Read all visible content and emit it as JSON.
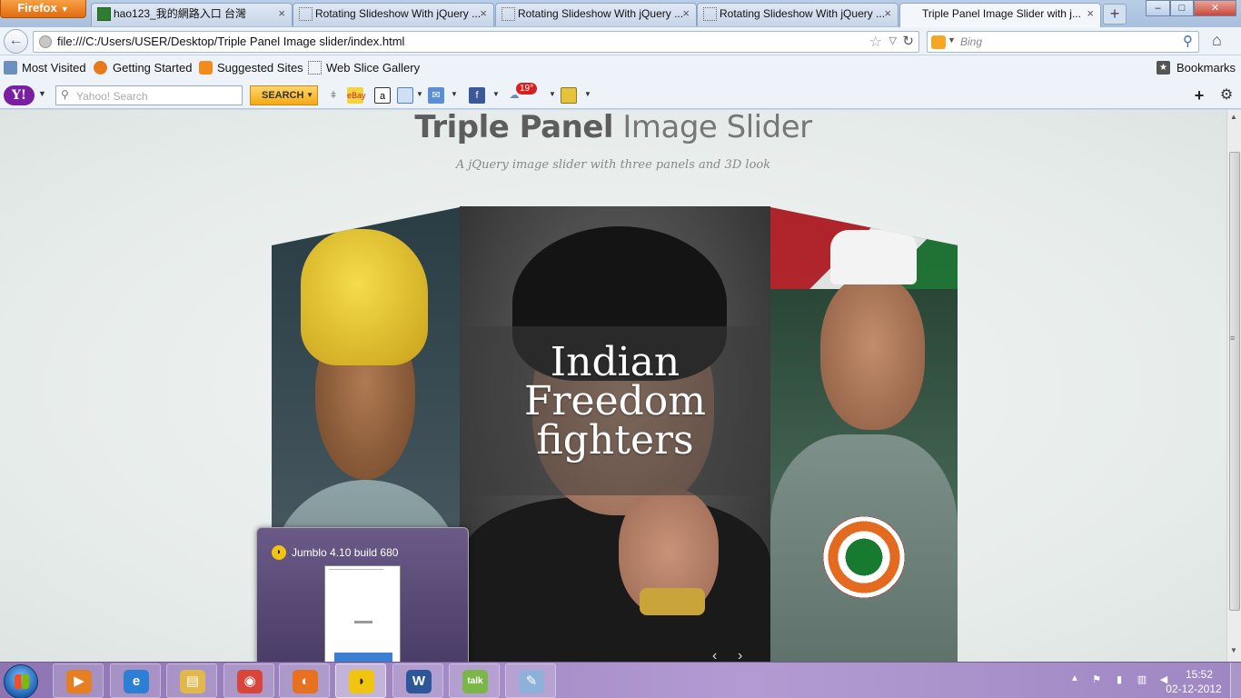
{
  "browser": {
    "menu_button": "Firefox",
    "tabs": [
      {
        "title": "hao123_我的網路入口 台灣"
      },
      {
        "title": "Rotating Slideshow With jQuery ..."
      },
      {
        "title": "Rotating Slideshow With jQuery ..."
      },
      {
        "title": "Rotating Slideshow With jQuery ..."
      },
      {
        "title": "Triple Panel Image Slider with j..."
      }
    ],
    "close_glyph": "×",
    "new_tab_glyph": "+",
    "url": "file:///C:/Users/USER/Desktop/Triple Panel Image slider/index.html",
    "search_engine_placeholder": "Bing",
    "window_buttons": {
      "minimize": "–",
      "maximize": "□",
      "close": "✕"
    }
  },
  "bookmarks": {
    "items": [
      "Most Visited",
      "Getting Started",
      "Suggested Sites",
      "Web Slice Gallery"
    ],
    "bookmarks_label": "Bookmarks"
  },
  "yahoo_toolbar": {
    "logo": "Y!",
    "search_placeholder": "Yahoo! Search",
    "search_button": "SEARCH",
    "weather_temp": "19°"
  },
  "page": {
    "title_bold": "Triple Panel",
    "title_light": "Image Slider",
    "subtitle": "A jQuery image slider with three panels and 3D look",
    "caption": [
      "Indian",
      "Freedom",
      "fighters"
    ]
  },
  "thumbnail_popup": {
    "title": "Jumblo 4.10 build 680"
  },
  "taskbar": {
    "pinned": [
      {
        "name": "media-player",
        "glyph": "▶",
        "color": "#e67e22"
      },
      {
        "name": "internet-explorer",
        "glyph": "e",
        "color": "#2d7fd3"
      },
      {
        "name": "windows-explorer",
        "glyph": "▤",
        "color": "#e0b84b"
      },
      {
        "name": "chrome",
        "glyph": "◉",
        "color": "#d8453a"
      },
      {
        "name": "firefox",
        "glyph": "◐",
        "color": "#e8711f"
      },
      {
        "name": "jumblo",
        "glyph": "◗",
        "color": "#f1c40f"
      },
      {
        "name": "word",
        "glyph": "W",
        "color": "#2b579a"
      },
      {
        "name": "google-talk",
        "glyph": "talk",
        "color": "#7ab648"
      },
      {
        "name": "paint",
        "glyph": "✎",
        "color": "#8db1d8"
      }
    ],
    "clock_time": "15:52",
    "clock_date": "02-12-2012"
  }
}
